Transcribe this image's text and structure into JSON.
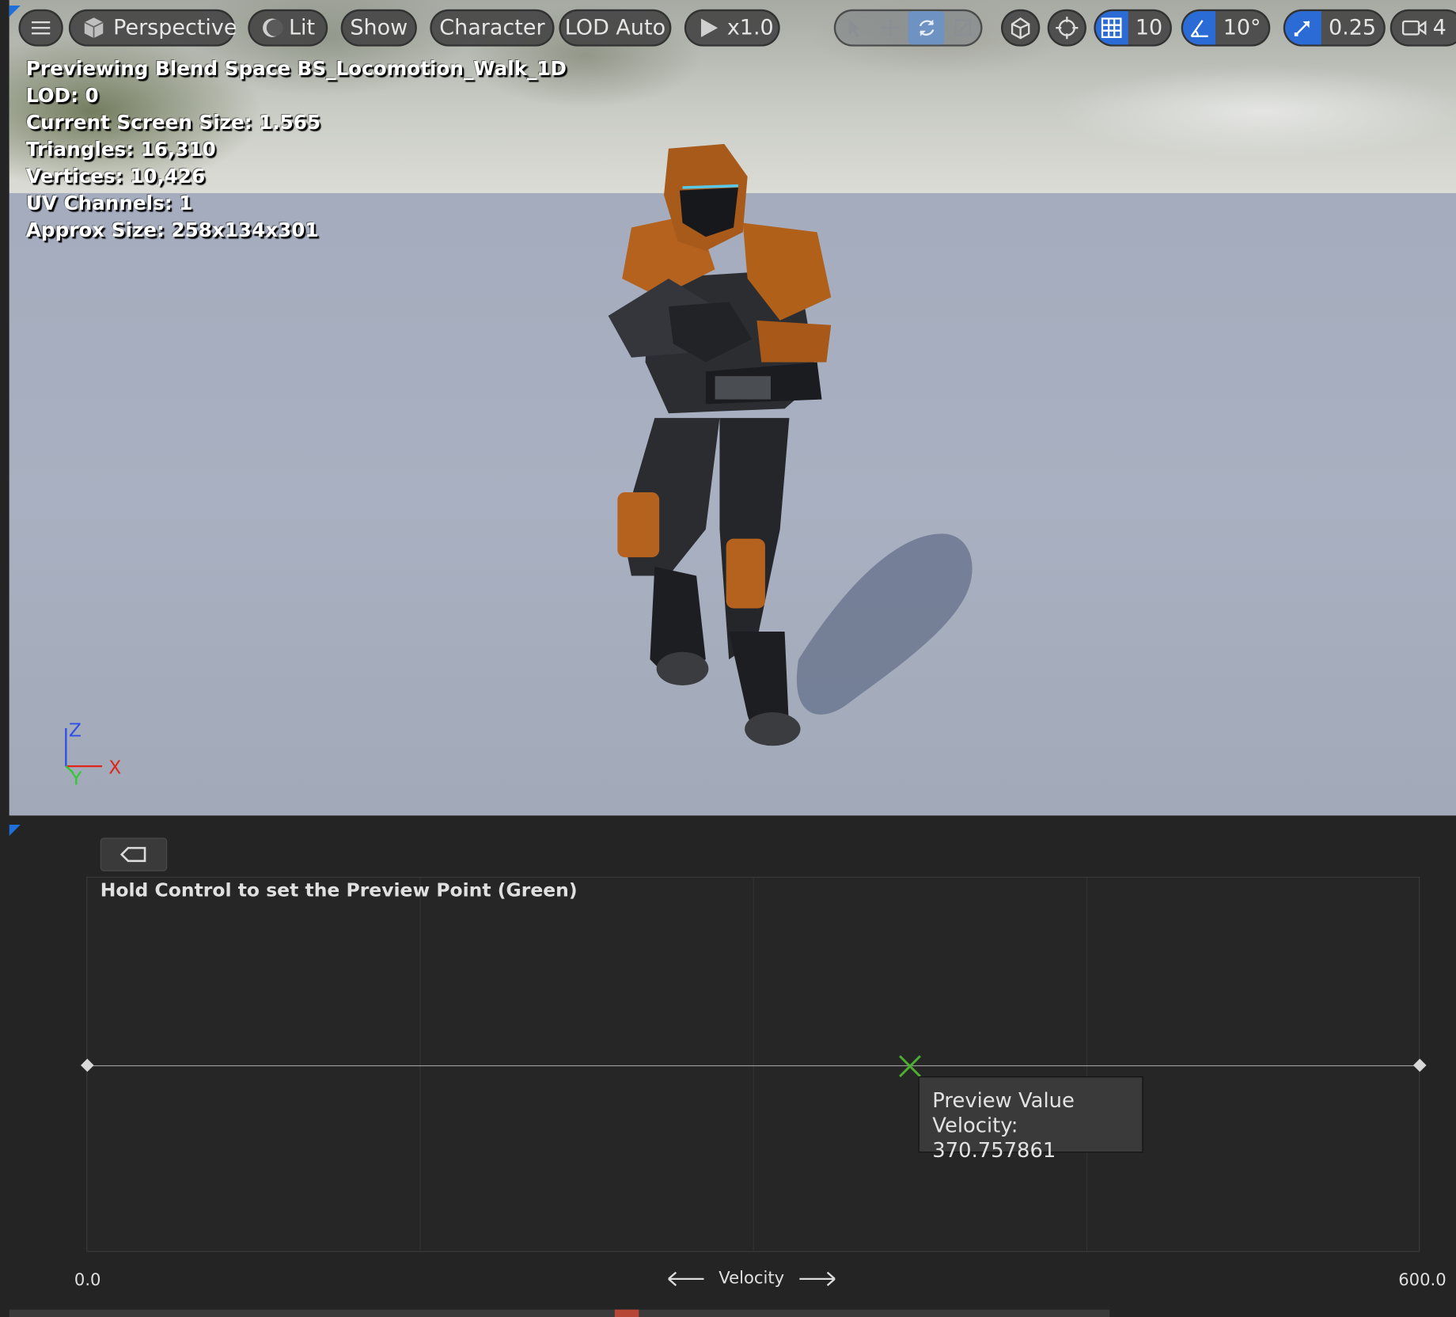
{
  "toolbar": {
    "view_mode": "Perspective",
    "lighting": "Lit",
    "show": "Show",
    "character": "Character",
    "lod": "LOD Auto",
    "play_speed": "x1.0",
    "grid_snap": "10",
    "rotation_snap": "10°",
    "scale_snap": "0.25",
    "camera_speed": "4"
  },
  "stats": {
    "line1": "Previewing Blend Space BS_Locomotion_Walk_1D",
    "line2": "LOD: 0",
    "line3": "Current Screen Size: 1.565",
    "line4": "Triangles: 16,310",
    "line5": "Vertices: 10,426",
    "line6": "UV Channels: 1",
    "line7": "Approx Size: 258x134x301"
  },
  "gizmo": {
    "z": "Z",
    "x": "X",
    "y": "Y"
  },
  "blendspace": {
    "hint": "Hold Control to set the Preview Point (Green)",
    "axis_min": "0.0",
    "axis_max": "600.0",
    "axis_name": "Velocity",
    "tooltip_title": "Preview Value",
    "tooltip_value": "Velocity: 370.757861",
    "preview_value": 370.757861,
    "range": [
      0,
      600
    ]
  },
  "colors": {
    "accent": "#2b6bd6",
    "preview_point": "#4caf2f",
    "axis_x": "#e0261b",
    "axis_y": "#2dcb2d",
    "axis_z": "#2f4fe6"
  }
}
